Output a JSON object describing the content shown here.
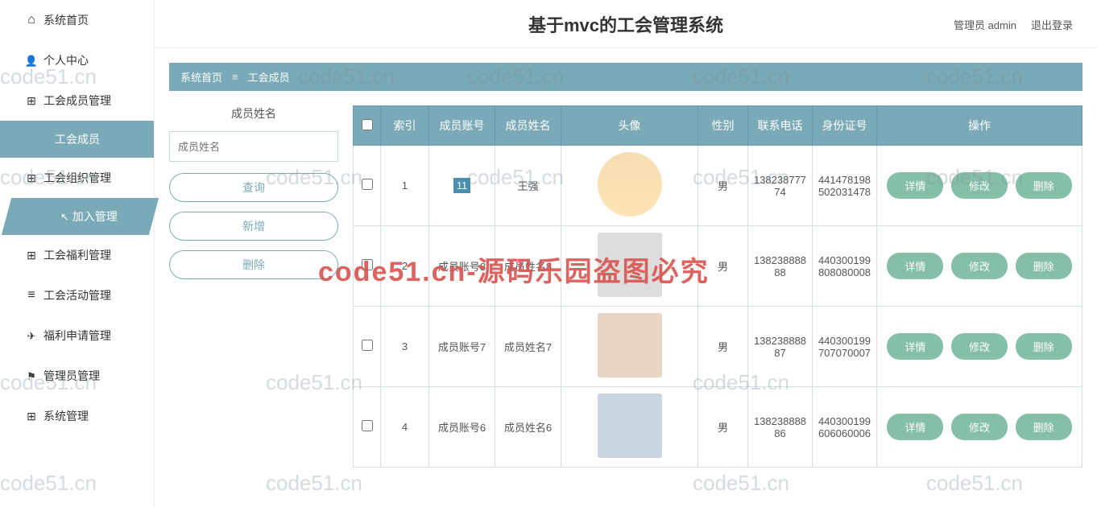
{
  "header": {
    "title": "基于mvc的工会管理系统",
    "admin_label": "管理员 admin",
    "logout": "退出登录"
  },
  "sidebar": {
    "home": "系统首页",
    "profile": "个人中心",
    "member_mgmt": "工会成员管理",
    "member_sub": "工会成员",
    "org_mgmt": "工会组织管理",
    "join_mgmt": "加入管理",
    "welfare_mgmt": "工会福利管理",
    "activity_mgmt": "工会活动管理",
    "welfare_apply": "福利申请管理",
    "admin_mgmt": "管理员管理",
    "system_mgmt": "系统管理"
  },
  "breadcrumb": {
    "home": "系统首页",
    "current": "工会成员"
  },
  "search": {
    "label": "成员姓名",
    "placeholder": "成员姓名",
    "query": "查询",
    "add": "新增",
    "delete": "删除"
  },
  "table": {
    "headers": {
      "index": "索引",
      "account": "成员账号",
      "name": "成员姓名",
      "avatar": "头像",
      "gender": "性别",
      "phone": "联系电话",
      "idcard": "身份证号",
      "actions": "操作"
    },
    "action_labels": {
      "detail": "详情",
      "edit": "修改",
      "delete": "删除"
    },
    "rows": [
      {
        "index": "1",
        "account": "11",
        "name": "王强",
        "gender": "男",
        "phone": "13823877774",
        "idcard": "441478198502031478"
      },
      {
        "index": "2",
        "account": "成员账号8",
        "name": "成员姓名8",
        "gender": "男",
        "phone": "13823888888",
        "idcard": "440300199808080008"
      },
      {
        "index": "3",
        "account": "成员账号7",
        "name": "成员姓名7",
        "gender": "男",
        "phone": "13823888887",
        "idcard": "440300199707070007"
      },
      {
        "index": "4",
        "account": "成员账号6",
        "name": "成员姓名6",
        "gender": "男",
        "phone": "13823888886",
        "idcard": "440300199606060006"
      }
    ]
  },
  "watermarks": {
    "main": "code51.cn-源码乐园盗图必究",
    "small": "code51.cn"
  }
}
